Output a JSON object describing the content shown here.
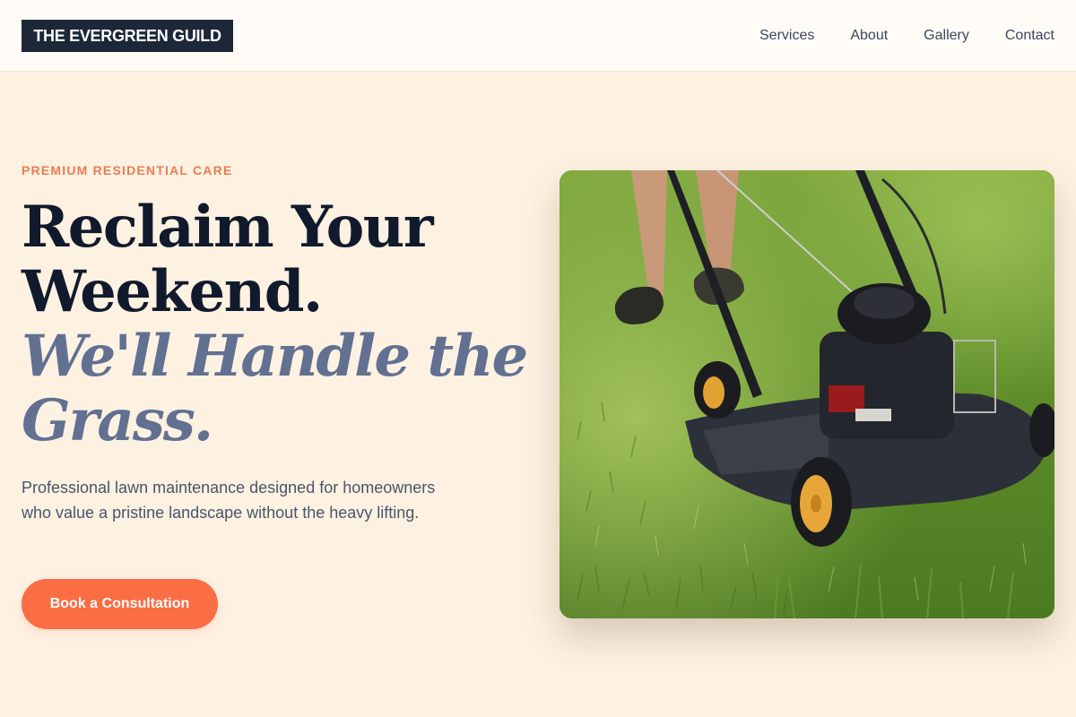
{
  "header": {
    "logo": "THE EVERGREEN GUILD",
    "nav": [
      {
        "label": "Services"
      },
      {
        "label": "About"
      },
      {
        "label": "Gallery"
      },
      {
        "label": "Contact"
      }
    ]
  },
  "hero": {
    "eyebrow": "PREMIUM RESIDENTIAL CARE",
    "headline_line1": "Reclaim Your",
    "headline_line2": "Weekend.",
    "headline_accent_line1": "We'll Handle the",
    "headline_accent_line2": "Grass.",
    "subcopy": "Professional lawn maintenance designed for homeowners who value a pristine landscape without the heavy lifting.",
    "cta_label": "Book a Consultation",
    "image_icon": "lawn-mower-photo"
  },
  "colors": {
    "background": "#fdf1e2",
    "header_bg": "#fffcf8",
    "logo_bg": "#1c2738",
    "accent": "#fb6d43",
    "eyebrow": "#ef7b52",
    "headline": "#111a2c",
    "headline_accent": "#627191",
    "body_text": "#4a5568"
  }
}
